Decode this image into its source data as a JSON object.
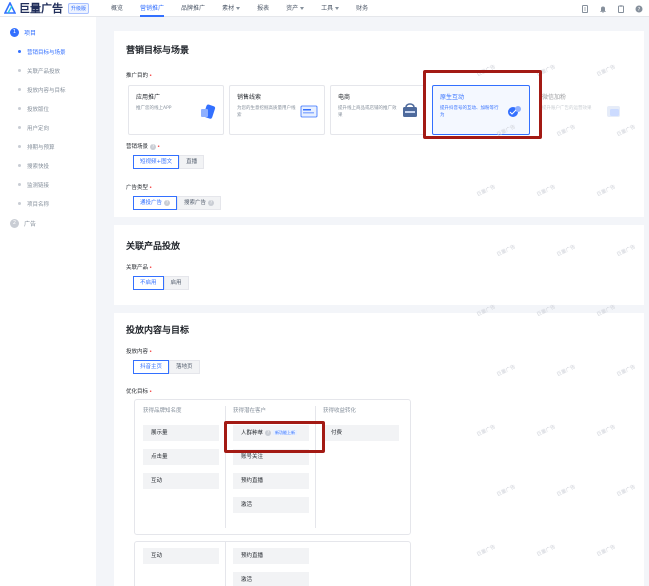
{
  "app": {
    "logo_text": "巨量广告",
    "badge": "升级版"
  },
  "nav": [
    {
      "label": "概览",
      "caret": false,
      "active": false
    },
    {
      "label": "营销推广",
      "caret": false,
      "active": true
    },
    {
      "label": "品牌推广",
      "caret": false,
      "active": false
    },
    {
      "label": "素材",
      "caret": true,
      "active": false
    },
    {
      "label": "报表",
      "caret": false,
      "active": false
    },
    {
      "label": "资产",
      "caret": true,
      "active": false
    },
    {
      "label": "工具",
      "caret": true,
      "active": false
    },
    {
      "label": "财务",
      "caret": false,
      "active": false
    }
  ],
  "top_icons": [
    "document-icon",
    "bell-icon",
    "clipboard-icon",
    "help-icon"
  ],
  "sidebar": {
    "step1": {
      "num": "1",
      "label": "项目"
    },
    "items": [
      {
        "label": "营销目标与场景",
        "active": true
      },
      {
        "label": "关联产品投放",
        "active": false
      },
      {
        "label": "投放内容与目标",
        "active": false
      },
      {
        "label": "投放版位",
        "active": false
      },
      {
        "label": "用户定向",
        "active": false
      },
      {
        "label": "排期与预算",
        "active": false
      },
      {
        "label": "搜索快投",
        "active": false
      },
      {
        "label": "监测链接",
        "active": false
      },
      {
        "label": "项目名称",
        "active": false
      }
    ],
    "step2": {
      "num": "2",
      "label": "广告"
    }
  },
  "section1": {
    "title": "营销目标与场景",
    "promo_label": "推广目的",
    "promo_cards": [
      {
        "title": "应用推广",
        "desc": "推广您的线上APP",
        "icon": "app-promo-icon",
        "selected": false,
        "ghost": false
      },
      {
        "title": "销售线索",
        "desc": "为您的生意挖掘高质量用户线索",
        "icon": "leads-icon",
        "selected": false,
        "ghost": false
      },
      {
        "title": "电商",
        "desc": "提升线上商品或店铺的推广效果",
        "icon": "ecommerce-icon",
        "selected": false,
        "ghost": false
      },
      {
        "title": "原生互动",
        "desc": "提升抖音号的互动、加粉等行为",
        "icon": "native-interaction-icon",
        "selected": true,
        "ghost": false
      },
      {
        "title": "微信加粉",
        "desc": "提升账户广告的运营效果",
        "icon": "wechat-icon",
        "selected": false,
        "ghost": true
      }
    ],
    "scene_label": "营销场景",
    "scene_options": [
      {
        "label": "短视频+图文",
        "on": true
      },
      {
        "label": "直播",
        "on": false
      }
    ],
    "adtype_label": "广告类型",
    "adtype_options": [
      {
        "label": "通投广告",
        "on": true,
        "help": true
      },
      {
        "label": "搜索广告",
        "on": false,
        "help": true
      }
    ]
  },
  "section2": {
    "title": "关联产品投放",
    "label": "关联产品",
    "options": [
      {
        "label": "不启用",
        "on": true
      },
      {
        "label": "启用",
        "on": false
      }
    ]
  },
  "section3": {
    "title": "投放内容与目标",
    "content_label": "投放内容",
    "content_options": [
      {
        "label": "抖音主页",
        "on": true
      },
      {
        "label": "落地页",
        "on": false
      }
    ],
    "goal_label": "优化目标",
    "col_headers": [
      "获得品牌知名度",
      "获得潜在客户",
      "获得收益转化"
    ],
    "col1": [
      "展示量",
      "点击量",
      "互动"
    ],
    "col2": [
      "人群种草",
      "账号关注",
      "预约直播",
      "激活"
    ],
    "col2_tag": "新功能上新",
    "col3": [
      "付费"
    ],
    "bottom_col1": [
      "互动"
    ],
    "bottom_col2": [
      "预约直播",
      "激活"
    ]
  },
  "watermark": "巨量广告",
  "colors": {
    "accent": "#3370ff",
    "highlight_box": "#a31a14"
  }
}
